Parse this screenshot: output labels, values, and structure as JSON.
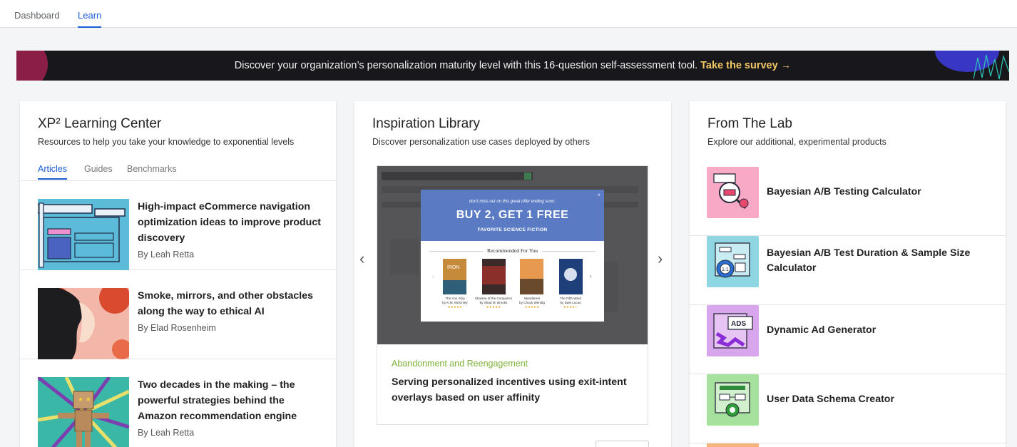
{
  "nav": {
    "tabs": [
      {
        "label": "Dashboard"
      },
      {
        "label": "Learn"
      }
    ]
  },
  "banner": {
    "text": "Discover your organization’s personalization maturity level with this 16-question self-assessment tool.",
    "cta": "Take the survey →"
  },
  "learning_center": {
    "title": "XP² Learning Center",
    "subtitle": "Resources to help you take your knowledge to exponential levels",
    "tabs": [
      {
        "label": "Articles"
      },
      {
        "label": "Guides"
      },
      {
        "label": "Benchmarks"
      }
    ],
    "articles": [
      {
        "title": "High-impact eCommerce navigation optimization ideas to improve product discovery",
        "author": "By Leah Retta"
      },
      {
        "title": "Smoke, mirrors, and other obstacles along the way to ethical AI",
        "author": "By Elad Rosenheim"
      },
      {
        "title": "Two decades in the making – the powerful strategies behind the Amazon recommendation engine",
        "author": "By Leah Retta"
      }
    ]
  },
  "inspiration": {
    "title": "Inspiration Library",
    "subtitle": "Discover personalization use cases deployed by others",
    "popup": {
      "small": "don't miss out on this great offer ending soon:",
      "headline": "BUY 2, GET 1 FREE",
      "subhead": "FAVORITE SCIENCE FICTION",
      "close": "×",
      "recommended": "Recommended For You",
      "books": [
        {
          "title": "The Iron Ship",
          "author": "by K.M. McKinley",
          "stars": "★★★★★"
        },
        {
          "title": "Shadow of the Conqueror",
          "author": "by Shad M. Brooks",
          "stars": "★★★★★"
        },
        {
          "title": "Wanderers",
          "author": "by Chuck Wendig",
          "stars": "★★★★★"
        },
        {
          "title": "The Fifth Ward",
          "author": "by Dale Lucas",
          "stars": "★★★★☆"
        }
      ]
    },
    "prev_icon": "‹",
    "next_icon": "›",
    "category": "Abandonment and Reengagement",
    "case_title": "Serving personalized incentives using exit-intent overlays based on user affinity"
  },
  "lab": {
    "title": "From The Lab",
    "subtitle": "Explore our additional, experimental products",
    "products": [
      {
        "name": "Bayesian A/B Testing Calculator",
        "icon": "magnifier-gear-icon",
        "color": "#f7a9c6"
      },
      {
        "name": "Bayesian A/B Test Duration & Sample Size Calculator",
        "icon": "calculator-gear-icon",
        "color": "#8fd6e3"
      },
      {
        "name": "Dynamic Ad Generator",
        "icon": "ads-window-icon",
        "color": "#d8a6ec",
        "badge": "ADS"
      },
      {
        "name": "User Data Schema Creator",
        "icon": "schema-gear-icon",
        "color": "#a6e29e"
      }
    ]
  }
}
